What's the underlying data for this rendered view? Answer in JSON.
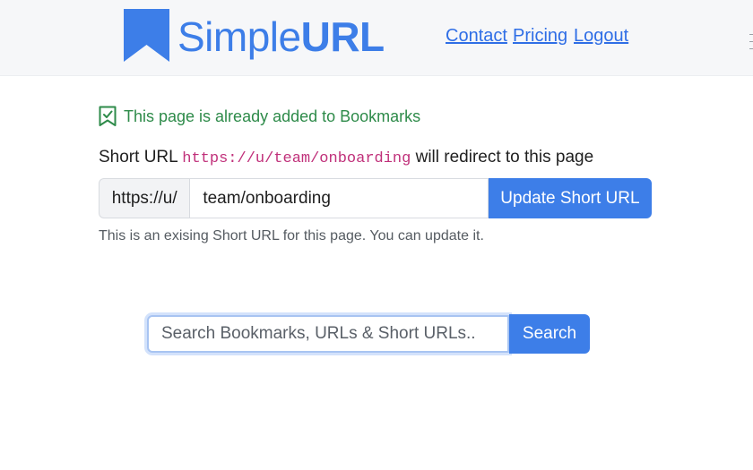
{
  "header": {
    "brand_light": "Simple",
    "brand_bold": "URL",
    "logo_icon": "bookmark-icon",
    "nav": {
      "contact": "Contact",
      "pricing": "Pricing",
      "logout": "Logout"
    }
  },
  "notice": {
    "icon": "bookmark-check-icon",
    "text": "This page is already added to Bookmarks"
  },
  "short_url": {
    "prefix_text": "Short URL",
    "url": "https://u/team/onboarding",
    "suffix_text": "will redirect to this page",
    "input_prefix": "https://u/",
    "input_value": "team/onboarding",
    "update_button": "Update Short URL",
    "help_text": "This is an exising Short URL for this page. You can update it."
  },
  "search": {
    "placeholder": "Search Bookmarks, URLs & Short URLs..",
    "button": "Search"
  },
  "colors": {
    "brand": "#3d7ee8",
    "success": "#2e8b4a",
    "code": "#c0307a",
    "link": "#2f6ee6"
  }
}
